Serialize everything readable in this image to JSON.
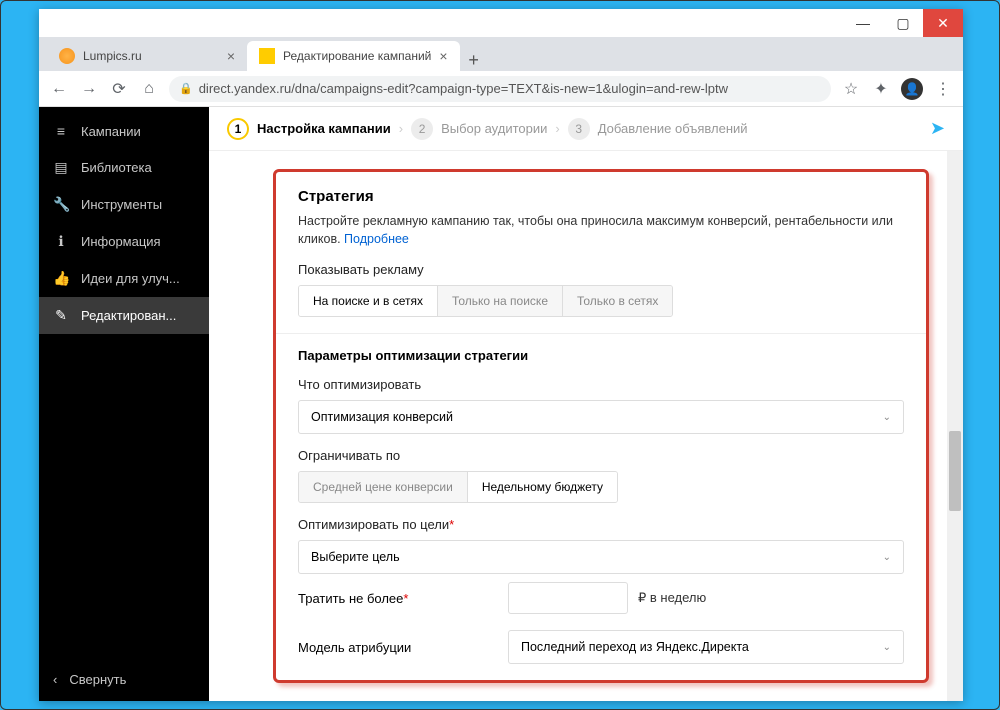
{
  "window": {
    "min": "—",
    "max": "▢",
    "close": "✕"
  },
  "tabs": {
    "t1": "Lumpics.ru",
    "t2": "Редактирование кампаний",
    "plus": "+"
  },
  "nav": {
    "back": "←",
    "fwd": "→",
    "reload": "⟳",
    "home": "⌂",
    "lock": "🔒",
    "url": "direct.yandex.ru/dna/campaigns-edit?campaign-type=TEXT&is-new=1&ulogin=and-rew-lptw",
    "star": "☆",
    "ext": "✦",
    "menu": "⋮"
  },
  "sidebar": {
    "items": [
      {
        "icon": "≡",
        "label": "Кампании"
      },
      {
        "icon": "▤",
        "label": "Библиотека"
      },
      {
        "icon": "🔧",
        "label": "Инструменты"
      },
      {
        "icon": "ℹ",
        "label": "Информация"
      },
      {
        "icon": "👍",
        "label": "Идеи для улуч..."
      },
      {
        "icon": "✎",
        "label": "Редактирован..."
      }
    ],
    "collapse": {
      "icon": "‹",
      "label": "Свернуть"
    }
  },
  "steps": {
    "s1": {
      "num": "1",
      "label": "Настройка кампании"
    },
    "s2": {
      "num": "2",
      "label": "Выбор аудитории"
    },
    "s3": {
      "num": "3",
      "label": "Добавление объявлений"
    },
    "chev": "›",
    "send": "➤"
  },
  "card": {
    "title": "Стратегия",
    "desc": "Настройте рекламную кампанию так, чтобы она приносила максимум конверсий, рентабельности или кликов. ",
    "more": "Подробнее",
    "show_label": "Показывать рекламу",
    "show_opts": [
      "На поиске и в сетях",
      "Только на поиске",
      "Только в сетях"
    ],
    "params_head": "Параметры оптимизации стратегии",
    "optimize_label": "Что оптимизировать",
    "optimize_value": "Оптимизация конверсий",
    "limit_label": "Ограничивать по",
    "limit_opts": [
      "Средней цене конверсии",
      "Недельному бюджету"
    ],
    "goal_label": "Оптимизировать по цели",
    "goal_value": "Выберите цель",
    "spend_label": "Тратить не более",
    "spend_suffix": "₽ в неделю",
    "attr_label": "Модель атрибуции",
    "attr_value": "Последний переход из Яндекс.Директа",
    "chev_down": "⌄"
  }
}
